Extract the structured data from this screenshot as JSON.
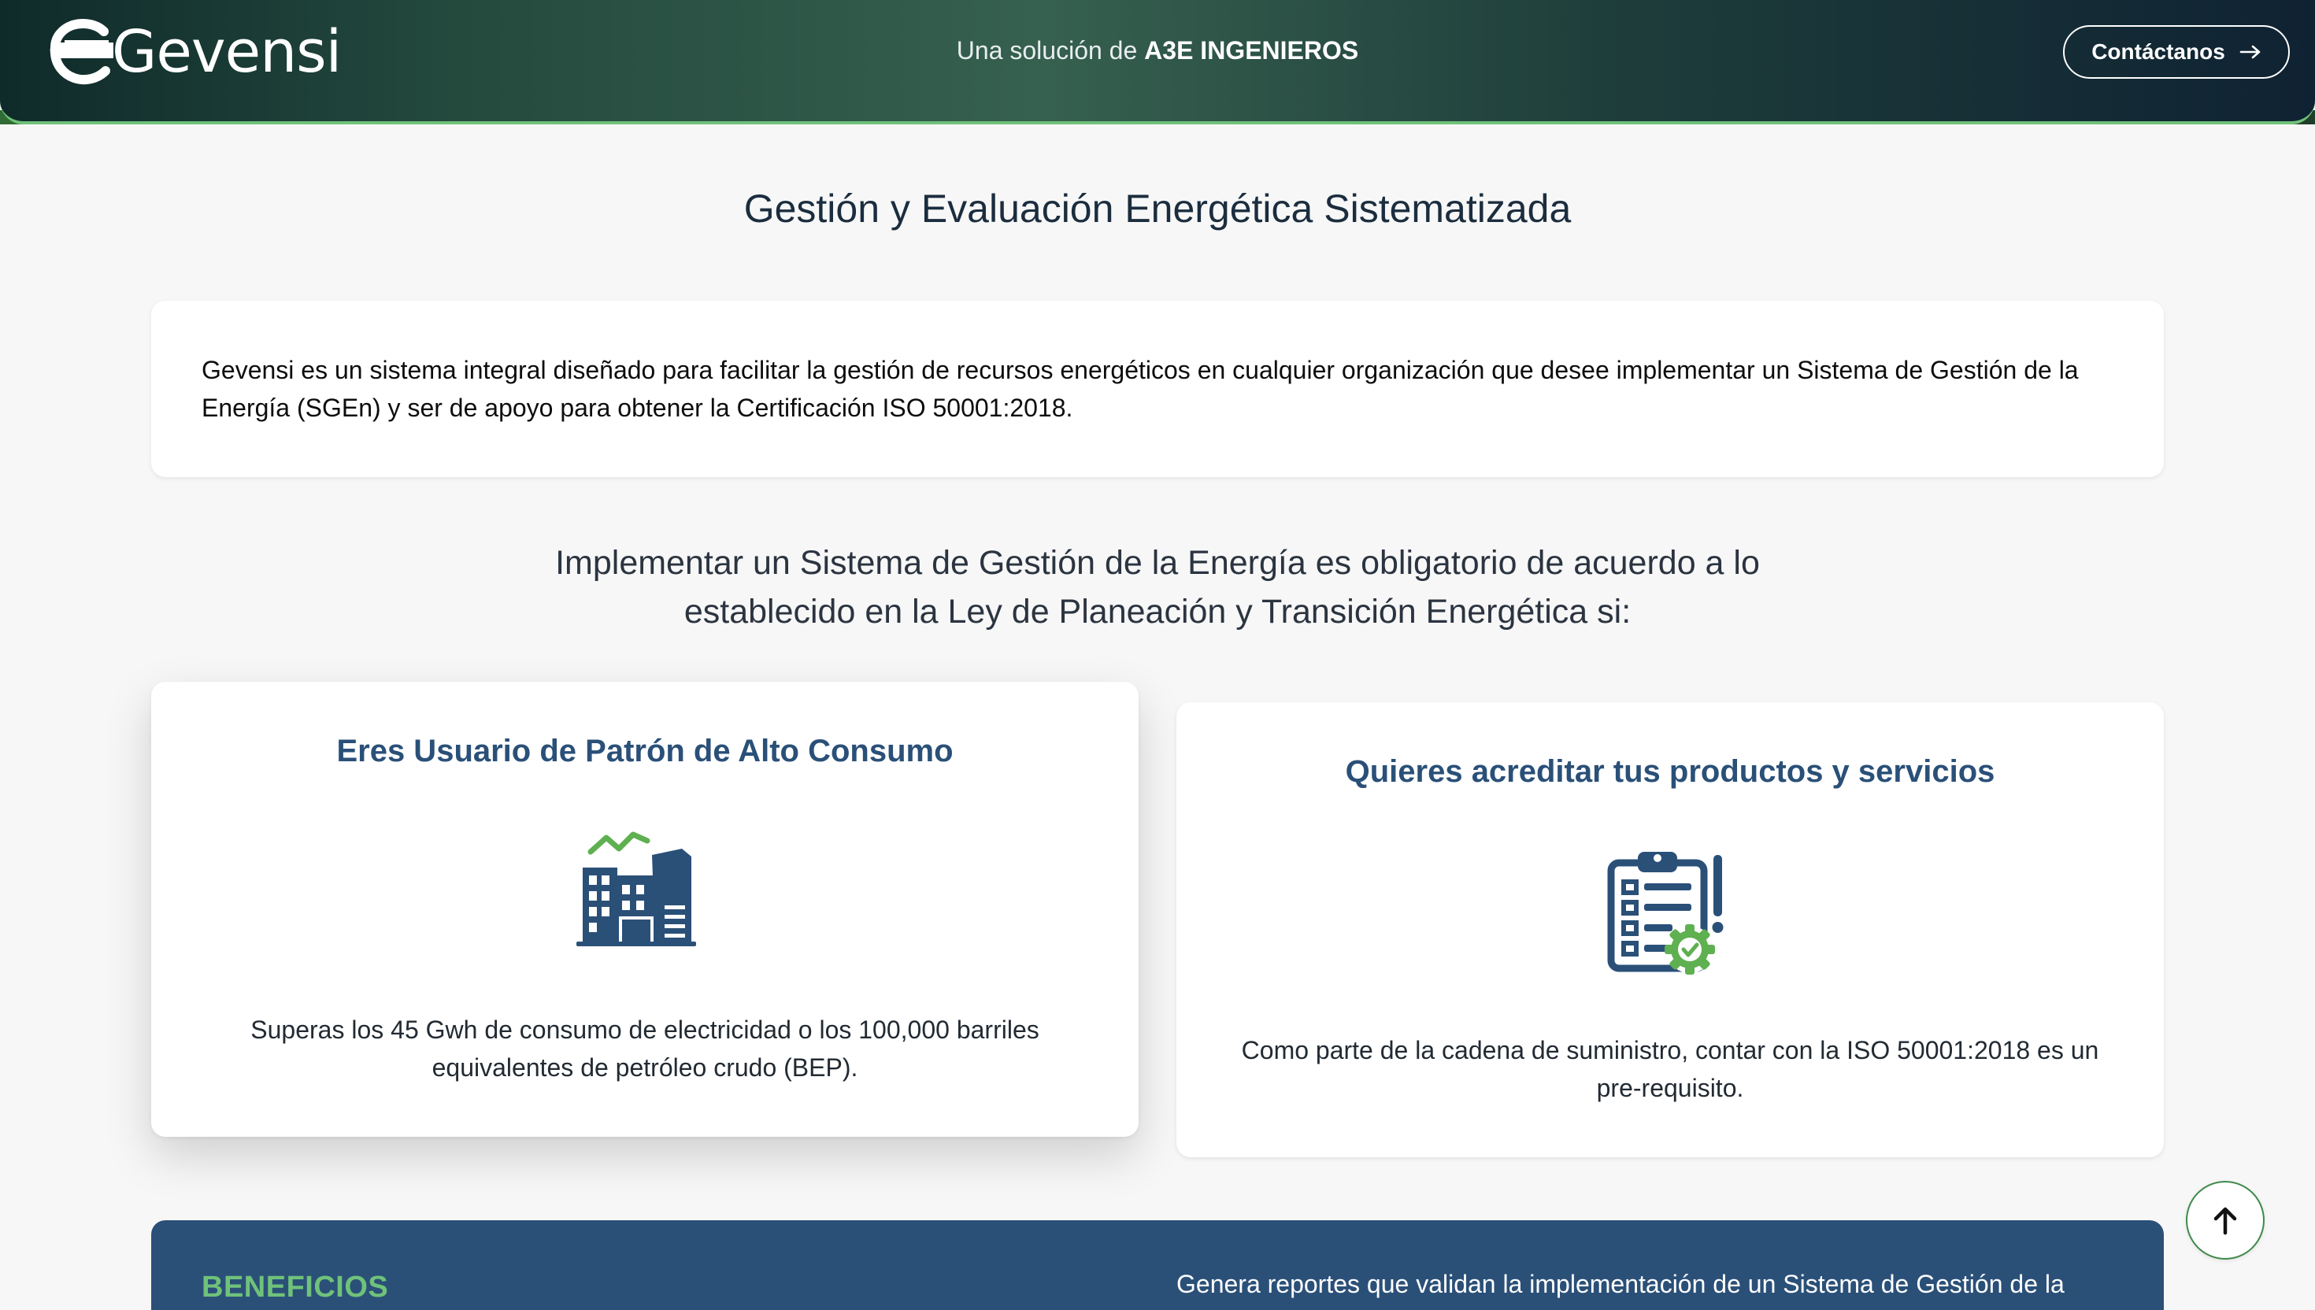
{
  "header": {
    "logo_text": "Gevensi",
    "tagline_prefix": "Una solución de",
    "tagline_brand": "A3E INGENIEROS",
    "contact_label": "Contáctanos",
    "contact_icon": "arrow-right-icon"
  },
  "main": {
    "title": "Gestión y Evaluación Energética Sistematizada",
    "intro": "Gevensi es un sistema integral diseñado para facilitar la gestión de recursos energéticos en cualquier organización que desee implementar un Sistema de Gestión de la Energía (SGEn) y ser de apoyo para obtener la Certificación ISO 50001:2018.",
    "subheading": "Implementar un Sistema de Gestión de la Energía es obligatorio de acuerdo a lo establecido en la Ley de Planeación y Transición Energética si:",
    "cards": [
      {
        "title": "Eres Usuario de Patrón de Alto Consumo",
        "icon": "buildings-chart-icon",
        "text": "Superas los 45 Gwh de consumo de electricidad o los 100,000 barriles equivalentes de petróleo crudo (BEP)."
      },
      {
        "title": "Quieres acreditar tus productos y servicios",
        "icon": "clipboard-check-icon",
        "text": "Como parte de la cadena de suministro, contar con la ISO 50001:2018 es un pre-requisito."
      }
    ]
  },
  "benefits": {
    "label": "BENEFICIOS",
    "text": "Genera reportes que validan la implementación de un Sistema de Gestión de la"
  },
  "scroll_top_icon": "arrow-up-icon",
  "colors": {
    "primary_blue": "#2a5078",
    "accent_green": "#6fc27a",
    "header_dark": "#0f2a2a"
  }
}
